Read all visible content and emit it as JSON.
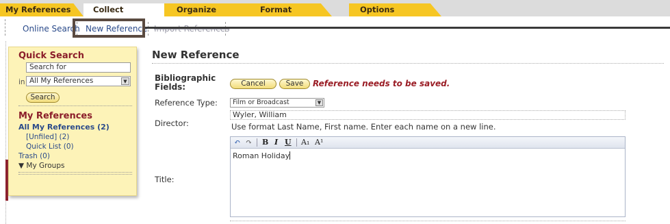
{
  "tabs": [
    {
      "label": "My References"
    },
    {
      "label": "Collect"
    },
    {
      "label": "Organize"
    },
    {
      "label": "Format"
    },
    {
      "label": "Options"
    }
  ],
  "subnav": {
    "online_search": "Online Search",
    "new_reference": "New Reference",
    "import_references": "Import References"
  },
  "sidebar": {
    "quick_search_title": "Quick Search",
    "search_input_value": "Search for",
    "in_label": "in",
    "scope_select_value": "All My References",
    "search_button": "Search",
    "my_references_title": "My References",
    "items": {
      "all": "All My References (2)",
      "unfiled": "[Unfiled] (2)",
      "quick_list": "Quick List (0)",
      "trash": "Trash (0)",
      "my_groups": "▼ My Groups"
    }
  },
  "main": {
    "title": "New Reference",
    "bib_fields_label": "Bibliographic Fields:",
    "cancel_button": "Cancel",
    "save_button": "Save",
    "status_message": "Reference needs to be saved.",
    "reference_type_label": "Reference Type:",
    "reference_type_value": "Film or Broadcast",
    "director_label": "Director:",
    "director_value": "Wyler, William",
    "director_hint": "Use format Last Name, First name. Enter each name on a new line.",
    "title_label": "Title:",
    "title_value": "Roman Holiday",
    "toolbar": {
      "undo": "↶",
      "redo": "↷",
      "bold": "B",
      "italic": "I",
      "underline": "U",
      "subscript": "A₁",
      "superscript": "A¹"
    }
  },
  "colors": {
    "tab_yellow": "#f6c623",
    "accent_maroon": "#8b1e2a",
    "sidebar_bg": "#fdf3b8",
    "link_blue": "#2a4a8a",
    "status_red": "#9a1d25"
  }
}
